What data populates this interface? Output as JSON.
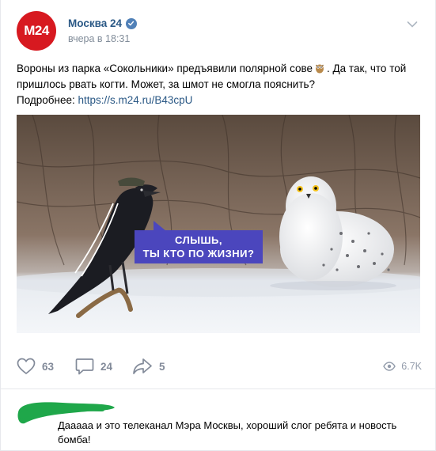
{
  "post": {
    "avatar_text": "M24",
    "author": "Москва 24",
    "time": "вчера в 18:31",
    "text_line1": "Вороны из парка «Сокольники» предъявили полярной сове",
    "text_line1b": ". Да так, что той",
    "text_line2": "пришлось рвать когти. Может, за шмот не смогла пояснить?",
    "more_label": "Подробнее:",
    "link": "https://s.m24.ru/B43cpU"
  },
  "image": {
    "bubble_line1": "СЛЫШЬ,",
    "bubble_line2": "ТЫ КТО ПО ЖИЗНИ?"
  },
  "actions": {
    "likes": "63",
    "comments": "24",
    "shares": "5",
    "views": "6.7K"
  },
  "comment": {
    "text_line1": "Дааааа и это телеканал Мэра Москвы, хороший слог ребята и новость",
    "text_line2": "бомба!"
  },
  "colors": {
    "accent": "#2a5885",
    "brand": "#d71920",
    "bubble": "#4b46bd",
    "scribble": "#1fa74a"
  },
  "icons": [
    "verified-icon",
    "chevron-down-icon",
    "owl-emoji-icon",
    "heart-icon",
    "comment-icon",
    "share-icon",
    "eye-icon"
  ]
}
